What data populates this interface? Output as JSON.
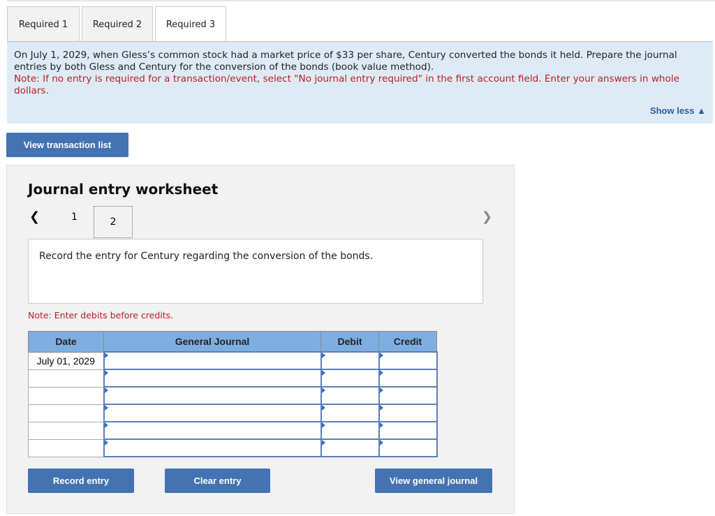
{
  "tabs": [
    "Required 1",
    "Required 2",
    "Required 3"
  ],
  "prompt": {
    "text": "On July 1, 2029, when Gless’s common stock had a market price of $33 per share, Century converted the bonds it held. Prepare the journal entries by both Gless and Century for the conversion of the bonds (book value method).",
    "note": "Note: If no entry is required for a transaction/event, select \"No journal entry required\" in the first account field. Enter your answers in whole dollars.",
    "show_less": "Show less ▲"
  },
  "view_transaction_list": "View transaction list",
  "worksheet": {
    "title": "Journal entry worksheet",
    "pages": [
      "1",
      "2"
    ],
    "current_page": "2",
    "question": "Record the entry for Century regarding the conversion of the bonds.",
    "note": "Note: Enter debits before credits.",
    "columns": [
      "Date",
      "General Journal",
      "Debit",
      "Credit"
    ],
    "rows": [
      {
        "date": "July 01, 2029"
      },
      {
        "date": ""
      },
      {
        "date": ""
      },
      {
        "date": ""
      },
      {
        "date": ""
      },
      {
        "date": ""
      }
    ]
  },
  "buttons": {
    "record": "Record entry",
    "clear": "Clear entry",
    "view_journal": "View general journal"
  }
}
